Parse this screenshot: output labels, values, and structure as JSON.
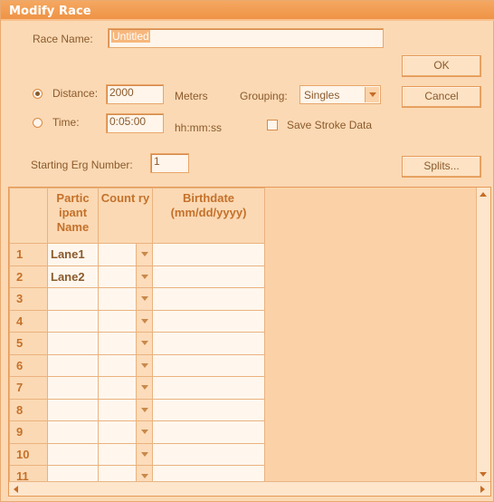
{
  "window": {
    "title": "Modify Race"
  },
  "form": {
    "race_name_label": "Race Name:",
    "race_name_value": "Untitled",
    "distance_label": "Distance:",
    "distance_value": "2000",
    "distance_unit": "Meters",
    "grouping_label": "Grouping:",
    "grouping_value": "Singles",
    "time_label": "Time:",
    "time_value": "0:05:00",
    "time_unit": "hh:mm:ss",
    "save_stroke_label": "Save Stroke Data",
    "starting_erg_label": "Starting Erg Number:",
    "starting_erg_value": "1",
    "mode_selected": "distance",
    "save_stroke_checked": false
  },
  "buttons": {
    "ok": "OK",
    "cancel": "Cancel",
    "splits": "Splits..."
  },
  "grid": {
    "columns": [
      "Partic ipant Name",
      "Count ry",
      "Birthdate (mm/dd/yyyy)"
    ],
    "rows": [
      {
        "num": "1",
        "name": "Lane1",
        "country": "",
        "birthdate": ""
      },
      {
        "num": "2",
        "name": "Lane2",
        "country": "",
        "birthdate": ""
      },
      {
        "num": "3",
        "name": "",
        "country": "",
        "birthdate": ""
      },
      {
        "num": "4",
        "name": "",
        "country": "",
        "birthdate": ""
      },
      {
        "num": "5",
        "name": "",
        "country": "",
        "birthdate": ""
      },
      {
        "num": "6",
        "name": "",
        "country": "",
        "birthdate": ""
      },
      {
        "num": "7",
        "name": "",
        "country": "",
        "birthdate": ""
      },
      {
        "num": "8",
        "name": "",
        "country": "",
        "birthdate": ""
      },
      {
        "num": "9",
        "name": "",
        "country": "",
        "birthdate": ""
      },
      {
        "num": "10",
        "name": "",
        "country": "",
        "birthdate": ""
      },
      {
        "num": "11",
        "name": "",
        "country": "",
        "birthdate": ""
      }
    ]
  },
  "colors": {
    "titlebar": "#ef9446",
    "background": "#fbd9b4",
    "text": "#8a5a2c",
    "header_text": "#c4712b"
  }
}
